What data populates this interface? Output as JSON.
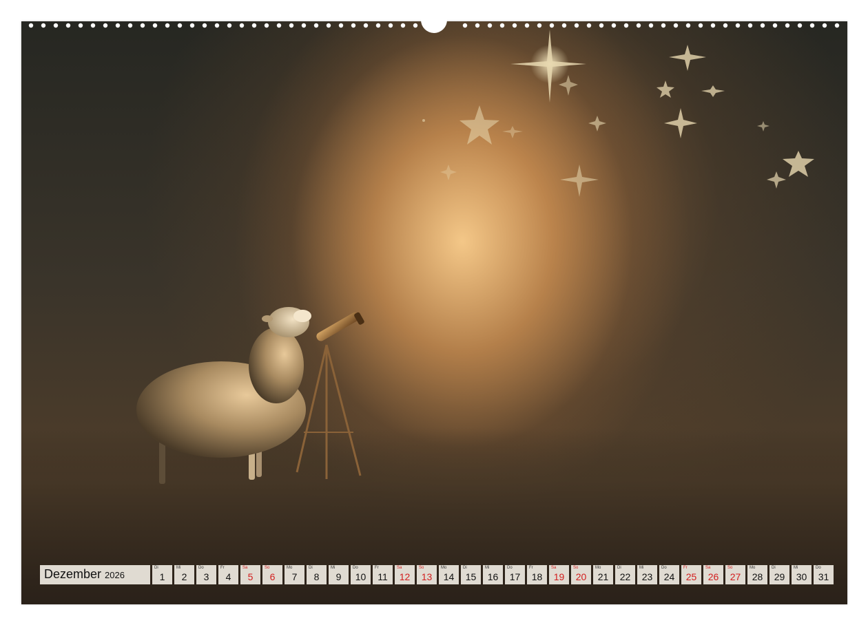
{
  "calendar": {
    "month": "Dezember",
    "year": "2026",
    "days": [
      {
        "abbr": "Di",
        "num": "1",
        "weekend": false
      },
      {
        "abbr": "Mi",
        "num": "2",
        "weekend": false
      },
      {
        "abbr": "Do",
        "num": "3",
        "weekend": false
      },
      {
        "abbr": "Fr",
        "num": "4",
        "weekend": false
      },
      {
        "abbr": "Sa",
        "num": "5",
        "weekend": true
      },
      {
        "abbr": "So",
        "num": "6",
        "weekend": true
      },
      {
        "abbr": "Mo",
        "num": "7",
        "weekend": false
      },
      {
        "abbr": "Di",
        "num": "8",
        "weekend": false
      },
      {
        "abbr": "Mi",
        "num": "9",
        "weekend": false
      },
      {
        "abbr": "Do",
        "num": "10",
        "weekend": false
      },
      {
        "abbr": "Fr",
        "num": "11",
        "weekend": false
      },
      {
        "abbr": "Sa",
        "num": "12",
        "weekend": true
      },
      {
        "abbr": "So",
        "num": "13",
        "weekend": true
      },
      {
        "abbr": "Mo",
        "num": "14",
        "weekend": false
      },
      {
        "abbr": "Di",
        "num": "15",
        "weekend": false
      },
      {
        "abbr": "Mi",
        "num": "16",
        "weekend": false
      },
      {
        "abbr": "Do",
        "num": "17",
        "weekend": false
      },
      {
        "abbr": "Fr",
        "num": "18",
        "weekend": false
      },
      {
        "abbr": "Sa",
        "num": "19",
        "weekend": true
      },
      {
        "abbr": "So",
        "num": "20",
        "weekend": true
      },
      {
        "abbr": "Mo",
        "num": "21",
        "weekend": false
      },
      {
        "abbr": "Di",
        "num": "22",
        "weekend": false
      },
      {
        "abbr": "Mi",
        "num": "23",
        "weekend": false
      },
      {
        "abbr": "Do",
        "num": "24",
        "weekend": false
      },
      {
        "abbr": "Fr",
        "num": "25",
        "weekend": true
      },
      {
        "abbr": "Sa",
        "num": "26",
        "weekend": true
      },
      {
        "abbr": "So",
        "num": "27",
        "weekend": true
      },
      {
        "abbr": "Mo",
        "num": "28",
        "weekend": false
      },
      {
        "abbr": "Di",
        "num": "29",
        "weekend": false
      },
      {
        "abbr": "Mi",
        "num": "30",
        "weekend": false
      },
      {
        "abbr": "Do",
        "num": "31",
        "weekend": false
      }
    ]
  },
  "colors": {
    "cell_background": "#e0dbd2",
    "weekend_red": "#d21e1e",
    "text_dark": "#111111"
  }
}
